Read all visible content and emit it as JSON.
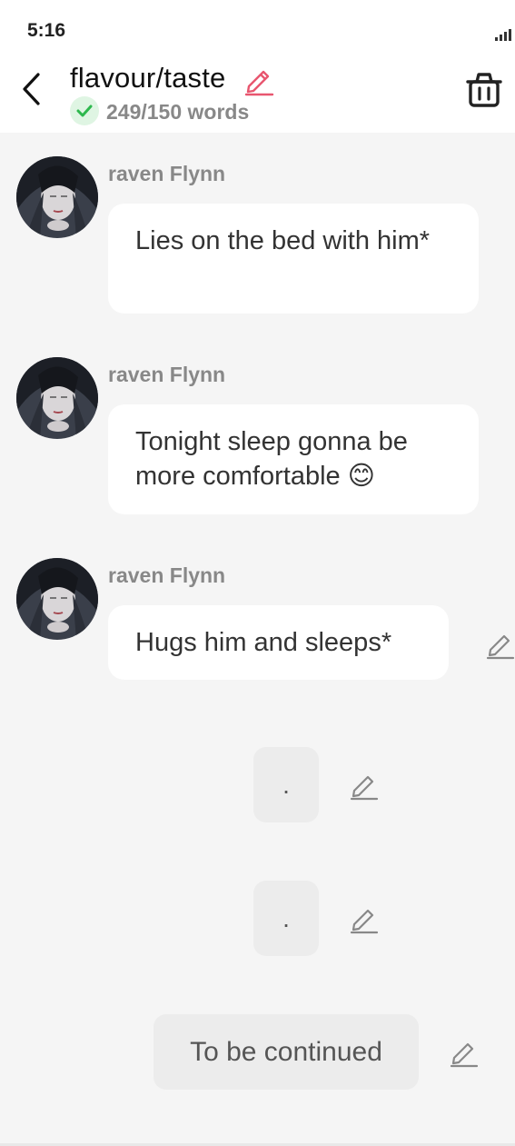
{
  "status": {
    "time": "5:16"
  },
  "header": {
    "title": "flavour/taste",
    "word_count": "249/150 words"
  },
  "messages": [
    {
      "sender": "raven Flynn",
      "text": "Lies on the bed with him*"
    },
    {
      "sender": "raven Flynn",
      "text": "Tonight sleep gonna be more comfortable 😊"
    },
    {
      "sender": "raven Flynn",
      "text": "Hugs him and sleeps*"
    }
  ],
  "user_messages": [
    {
      "text": "."
    },
    {
      "text": "."
    },
    {
      "text": "To be continued"
    }
  ],
  "colors": {
    "accent_pink": "#e8566f",
    "check_green": "#2db84d"
  }
}
